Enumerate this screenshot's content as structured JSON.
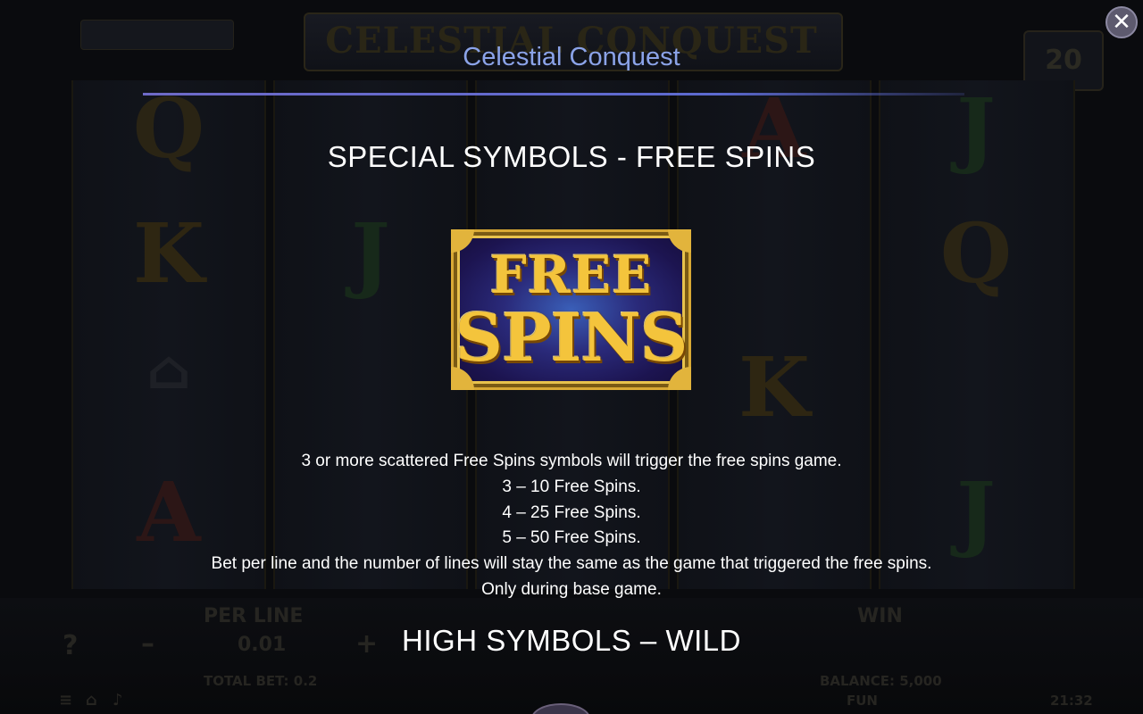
{
  "background": {
    "game_title": "CELESTIAL CONQUEST",
    "lines_value": "20",
    "per_line_label": "PER LINE",
    "per_line_value": "0.01",
    "total_bet": "TOTAL BET: 0.2",
    "win_label": "WIN",
    "balance": "BALANCE: 5,000",
    "fun_label": "FUN",
    "clock": "21:32",
    "help_symbol": "?",
    "minus_symbol": "–",
    "plus_symbol": "+"
  },
  "overlay": {
    "title": "Celestial Conquest",
    "close_symbol": "✕",
    "section_heading": "SPECIAL SYMBOLS - FREE SPINS",
    "symbol_line1": "FREE",
    "symbol_line2": "SPINS",
    "description": [
      "3 or more scattered Free Spins symbols will trigger the free spins game.",
      "3 – 10 Free Spins.",
      "4 – 25 Free Spins.",
      "5 – 50 Free Spins.",
      "Bet per line and the number of lines will stay the same as the game that triggered the free spins.",
      "Only during base game."
    ],
    "next_heading": "HIGH SYMBOLS – WILD"
  },
  "colors": {
    "title": "#8ba3e8",
    "rule": "#6e6ac8",
    "symbol_gold": "#f4c43c",
    "symbol_bg": "#1c1450"
  }
}
